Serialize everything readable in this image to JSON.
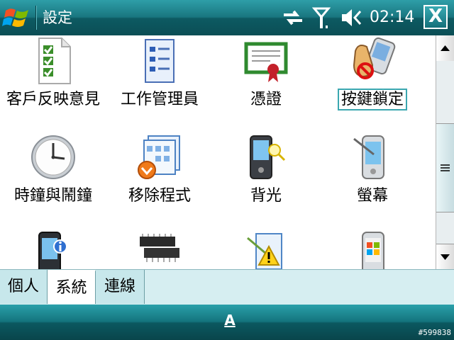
{
  "titlebar": {
    "title": "設定",
    "time": "02:14",
    "close_label": "X"
  },
  "items": [
    {
      "label": "客戶反映意見",
      "icon": "feedback-checklist-icon"
    },
    {
      "label": "工作管理員",
      "icon": "task-manager-icon"
    },
    {
      "label": "憑證",
      "icon": "certificate-icon"
    },
    {
      "label": "按鍵鎖定",
      "icon": "button-lock-icon",
      "selected": true
    },
    {
      "label": "時鐘與鬧鐘",
      "icon": "clock-icon"
    },
    {
      "label": "移除程式",
      "icon": "remove-programs-icon"
    },
    {
      "label": "背光",
      "icon": "backlight-icon"
    },
    {
      "label": "螢幕",
      "icon": "screen-icon"
    },
    {
      "label": "",
      "icon": "about-device-icon"
    },
    {
      "label": "",
      "icon": "memory-chip-icon"
    },
    {
      "label": "",
      "icon": "error-reporting-icon"
    },
    {
      "label": "",
      "icon": "windows-phone-icon"
    }
  ],
  "tabs": [
    {
      "label": "個人"
    },
    {
      "label": "系統",
      "active": true
    },
    {
      "label": "連線"
    }
  ],
  "bottom": {
    "input_label": "A"
  },
  "watermark": "#599838"
}
